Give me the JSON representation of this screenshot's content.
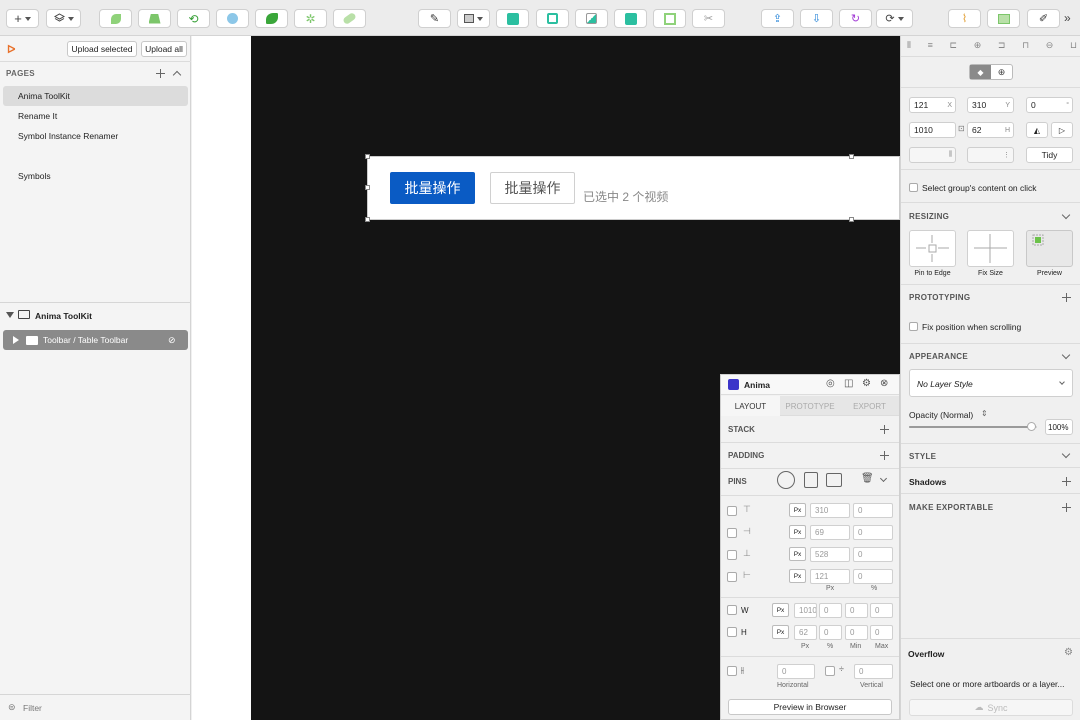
{
  "left_panel": {
    "upload_selected": "Upload selected",
    "upload_all": "Upload all",
    "pages_label": "PAGES",
    "pages": [
      "Anima ToolKit",
      "Rename It",
      "Symbol Instance Renamer",
      "Symbols"
    ],
    "layers_page_title": "Anima ToolKit",
    "layer_item": "Toolbar / Table Toolbar",
    "filter_label": "Filter"
  },
  "artboard": {
    "primary_button": "批量操作",
    "secondary_button": "批量操作",
    "selection_text": "已选中 2 个视频"
  },
  "inspector": {
    "x": "121",
    "x_suffix": "X",
    "y": "310",
    "y_suffix": "Y",
    "rotation": "0",
    "rotation_suffix": "°",
    "w": "1010",
    "w_suffix": "W",
    "h": "62",
    "h_suffix": "H",
    "tidy": "Tidy",
    "select_group_content": "Select group's content on click",
    "resizing_label": "RESIZING",
    "pin_to_edge": "Pin to Edge",
    "fix_size": "Fix Size",
    "preview": "Preview",
    "prototyping_label": "PROTOTYPING",
    "fix_position": "Fix position when scrolling",
    "appearance_label": "APPEARANCE",
    "layer_style": "No Layer Style",
    "opacity_label": "Opacity (Normal)",
    "opacity_value": "100%",
    "opacity_fraction": 0.96,
    "style_label": "STYLE",
    "shadows_label": "Shadows",
    "make_exportable": "MAKE EXPORTABLE",
    "overflow_title": "Overflow",
    "overflow_msg": "Select one or more artboards or a layer...",
    "sync": "Sync"
  },
  "anima": {
    "title": "Anima",
    "tabs": [
      "LAYOUT",
      "PROTOTYPE",
      "EXPORT"
    ],
    "stack": "STACK",
    "padding": "PADDING",
    "pins": "PINS",
    "pin_rows": [
      {
        "unit": "Px",
        "value": "310",
        "percent": "0"
      },
      {
        "unit": "Px",
        "value": "69",
        "percent": "0"
      },
      {
        "unit": "Px",
        "value": "528",
        "percent": "0"
      },
      {
        "unit": "Px",
        "value": "121",
        "percent": "0"
      }
    ],
    "col_px": "Px",
    "col_pct": "%",
    "w_label": "W",
    "h_label": "H",
    "w_values": {
      "unit": "Px",
      "px": "1010",
      "pct": "0",
      "min": "0",
      "max": "0"
    },
    "h_values": {
      "unit": "Px",
      "px": "62",
      "pct": "0",
      "min": "0",
      "max": "0"
    },
    "size_cols": [
      "Px",
      "%",
      "Min",
      "Max"
    ],
    "horizontal_value": "0",
    "vertical_value": "0",
    "horizontal": "Horizontal",
    "vertical": "Vertical",
    "preview_in_browser": "Preview in Browser"
  },
  "colors": {
    "primary_blue": "#0a5bc4",
    "canvas": "#141414"
  }
}
